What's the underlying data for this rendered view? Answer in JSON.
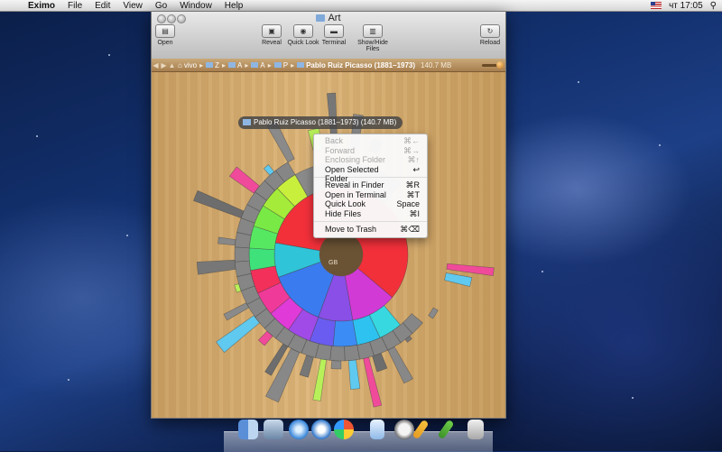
{
  "menubar": {
    "app_name": "Eximo",
    "items": [
      "File",
      "Edit",
      "View",
      "Go",
      "Window",
      "Help"
    ],
    "clock": "чт 17:05"
  },
  "window": {
    "title": "Art",
    "toolbar": {
      "open": "Open",
      "reveal": "Reveal",
      "quick_look": "Quick Look",
      "terminal": "Terminal",
      "show_hide": "Show/Hide Files",
      "reload": "Reload"
    },
    "path": {
      "crumbs": [
        "vivo",
        "Z",
        "A",
        "A",
        "P"
      ],
      "current": "Pablo Ruiz Picasso (1881–1973)",
      "size": "140.7 MB"
    },
    "tooltip": "Pablo Ruiz Picasso (1881–1973) (140.7 MB)",
    "center_label": "GB"
  },
  "context_menu": {
    "group1": [
      {
        "label": "Back",
        "shortcut": "⌘←",
        "disabled": true
      },
      {
        "label": "Forward",
        "shortcut": "⌘→",
        "disabled": true
      },
      {
        "label": "Enclosing Folder",
        "shortcut": "⌘↑",
        "disabled": true
      },
      {
        "label": "Open Selected Folder",
        "shortcut": "↩",
        "disabled": false
      }
    ],
    "group2": [
      {
        "label": "Reveal in Finder",
        "shortcut": "⌘R"
      },
      {
        "label": "Open in Terminal",
        "shortcut": "⌘T"
      },
      {
        "label": "Quick Look",
        "shortcut": "Space"
      },
      {
        "label": "Hide Files",
        "shortcut": "⌘I"
      }
    ],
    "group3": [
      {
        "label": "Move to Trash",
        "shortcut": "⌘⌫"
      }
    ]
  },
  "dock": {
    "apps": [
      "finder",
      "preview",
      "safari",
      "itunes",
      "eximo",
      "sprayer",
      "robot",
      "pencil",
      "brush",
      "trash"
    ]
  }
}
